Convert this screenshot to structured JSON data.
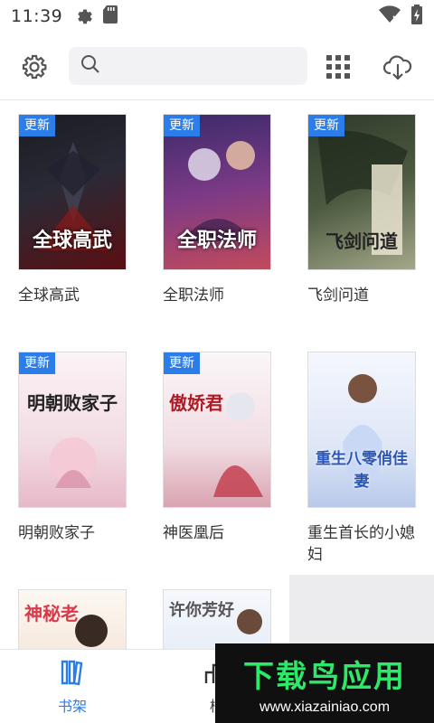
{
  "status_bar": {
    "time": "11:39",
    "icons_left": [
      "gear-icon",
      "sd-card-icon"
    ],
    "icons_right": [
      "wifi-icon",
      "battery-charging-icon"
    ]
  },
  "toolbar": {
    "search_placeholder": "",
    "icons": [
      "settings-icon",
      "search-icon",
      "grid-icon",
      "cloud-download-icon"
    ]
  },
  "books": [
    {
      "title": "全球高武",
      "badge": "更新",
      "cover_text": "全球高武",
      "cover_colors": [
        "#1b1b22",
        "#5a0f12"
      ]
    },
    {
      "title": "全职法师",
      "badge": "更新",
      "cover_text": "全职法师",
      "cover_colors": [
        "#3a2a6a",
        "#c24a5c"
      ]
    },
    {
      "title": "飞剑问道",
      "badge": "更新",
      "cover_text": "飞剑问道",
      "cover_colors": [
        "#2e3a2a",
        "#6b7a4a"
      ]
    },
    {
      "title": "明朝败家子",
      "badge": "更新",
      "cover_text": "明朝败家子",
      "cover_colors": [
        "#f6e9ee",
        "#e8b9c8"
      ]
    },
    {
      "title": "神医凰后",
      "badge": "更新",
      "cover_text": "傲娇君",
      "cover_colors": [
        "#f7eef2",
        "#d9a3b0"
      ]
    },
    {
      "title": "重生首长的小媳妇",
      "badge": "",
      "cover_text": "重生八零俏佳妻",
      "cover_colors": [
        "#eef2fb",
        "#b8c9ea"
      ]
    },
    {
      "title": "",
      "badge": "",
      "cover_text": "神秘老",
      "cover_colors": [
        "#fbf5f0",
        "#e9c9b5"
      ]
    },
    {
      "title": "",
      "badge": "",
      "cover_text": "许你芳好",
      "cover_colors": [
        "#f1f5fb",
        "#c9d8f0"
      ]
    }
  ],
  "tabs": {
    "shelf_label": "书架",
    "rank_label": "榜"
  },
  "watermark": {
    "title": "下载鸟应用",
    "url": "www.xiazainiao.com"
  },
  "colors": {
    "accent": "#2b7de9",
    "badge": "#2b7de9",
    "watermark_green": "#2ee86a"
  }
}
